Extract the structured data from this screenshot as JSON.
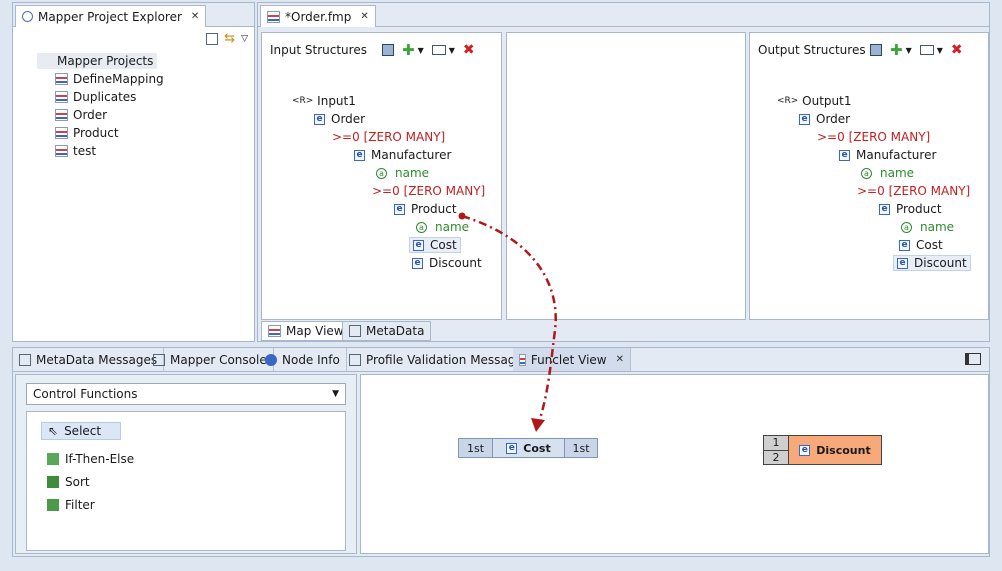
{
  "explorer": {
    "tab_label": "Mapper Project Explorer",
    "root": "Mapper Projects",
    "items": [
      "DefineMapping",
      "Duplicates",
      "Order",
      "Product",
      "test"
    ]
  },
  "editor": {
    "tab_label": "*Order.fmp",
    "input_title": "Input Structures",
    "output_title": "Output Structures",
    "bottom_tabs": [
      "Map View",
      "MetaData"
    ]
  },
  "input_tree": {
    "root": "Input1",
    "order": "Order",
    "cardinality1": "[ZERO MANY]",
    "manufacturer": "Manufacturer",
    "name1": "name",
    "cardinality2": "[ZERO MANY]",
    "product": "Product",
    "name2": "name",
    "cost": "Cost",
    "discount": "Discount"
  },
  "output_tree": {
    "root": "Output1",
    "order": "Order",
    "cardinality1": "[ZERO MANY]",
    "manufacturer": "Manufacturer",
    "name1": "name",
    "cardinality2": "[ZERO MANY]",
    "product": "Product",
    "name2": "name",
    "cost": "Cost",
    "discount": "Discount"
  },
  "tree_markers": {
    "ref": "<R>",
    "element": "e",
    "attribute": "a",
    "gte": ">=0"
  },
  "bottom_tabs": [
    "MetaData Messages",
    "Mapper Console",
    "Node Info",
    "Profile Validation Messages",
    "Funclet View"
  ],
  "functions": {
    "dropdown_value": "Control Functions",
    "items": [
      "Select",
      "If-Then-Else",
      "Sort",
      "Filter"
    ]
  },
  "funclet": {
    "cost_node": {
      "left": "1st",
      "label": "Cost",
      "right": "1st"
    },
    "discount_node": {
      "row1": "1",
      "row2": "2",
      "label": "Discount"
    }
  },
  "colors": {
    "accent_red": "#c32020",
    "discount_fill": "#f7a97a",
    "cost_fill": "#c9d6e8"
  }
}
